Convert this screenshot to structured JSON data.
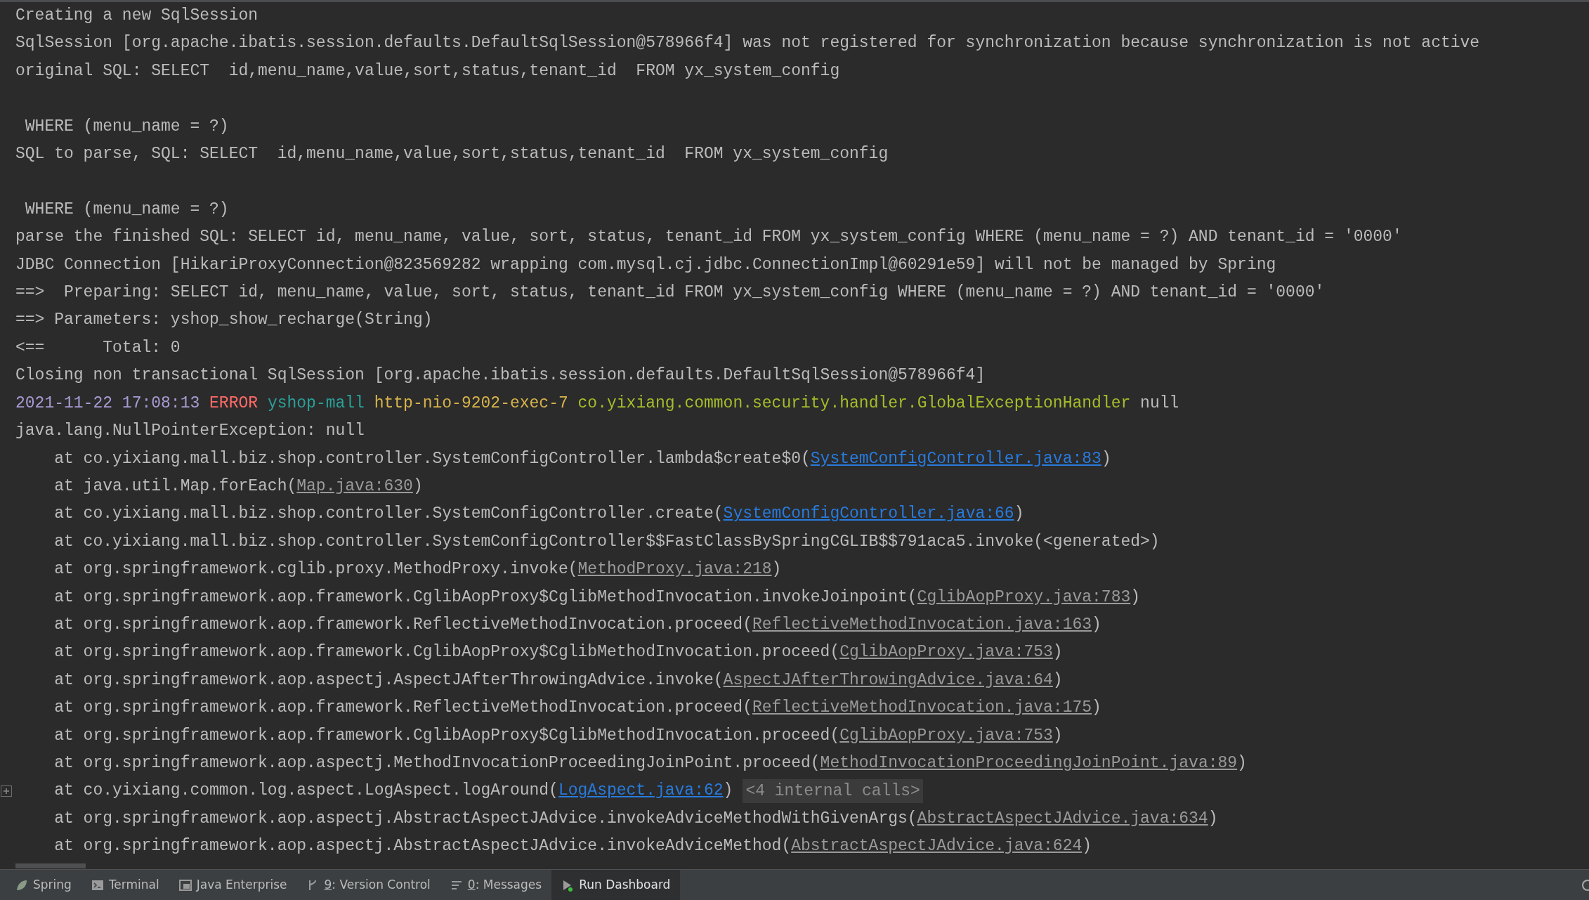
{
  "console": {
    "lines": [
      {
        "segments": [
          {
            "kind": "text",
            "text": "Creating a new SqlSession"
          }
        ]
      },
      {
        "segments": [
          {
            "kind": "text",
            "text": "SqlSession [org.apache.ibatis.session.defaults.DefaultSqlSession@578966f4] was not registered for synchronization because synchronization is not active"
          }
        ]
      },
      {
        "segments": [
          {
            "kind": "text",
            "text": "original SQL: SELECT  id,menu_name,value,sort,status,tenant_id  FROM yx_system_config\n\n WHERE (menu_name = ?)"
          }
        ]
      },
      {
        "segments": [
          {
            "kind": "text",
            "text": "SQL to parse, SQL: SELECT  id,menu_name,value,sort,status,tenant_id  FROM yx_system_config\n\n WHERE (menu_name = ?)"
          }
        ]
      },
      {
        "segments": [
          {
            "kind": "text",
            "text": "parse the finished SQL: SELECT id, menu_name, value, sort, status, tenant_id FROM yx_system_config WHERE (menu_name = ?) AND tenant_id = '0000'"
          }
        ]
      },
      {
        "segments": [
          {
            "kind": "text",
            "text": "JDBC Connection [HikariProxyConnection@823569282 wrapping com.mysql.cj.jdbc.ConnectionImpl@60291e59] will not be managed by Spring"
          }
        ]
      },
      {
        "segments": [
          {
            "kind": "text",
            "text": "==>  Preparing: SELECT id, menu_name, value, sort, status, tenant_id FROM yx_system_config WHERE (menu_name = ?) AND tenant_id = '0000'"
          }
        ]
      },
      {
        "segments": [
          {
            "kind": "text",
            "text": "==> Parameters: yshop_show_recharge(String)"
          }
        ]
      },
      {
        "segments": [
          {
            "kind": "text",
            "text": "<==      Total: 0"
          }
        ]
      },
      {
        "segments": [
          {
            "kind": "text",
            "text": "Closing non transactional SqlSession [org.apache.ibatis.session.defaults.DefaultSqlSession@578966f4]"
          }
        ]
      },
      {
        "segments": [
          {
            "kind": "date",
            "text": "2021-11-22 17:08:13 "
          },
          {
            "kind": "level",
            "text": "ERROR "
          },
          {
            "kind": "app",
            "text": "yshop-mall "
          },
          {
            "kind": "thread",
            "text": "http-nio-9202-exec-7 "
          },
          {
            "kind": "logger",
            "text": "co.yixiang.common.security.handler.GlobalExceptionHandler "
          },
          {
            "kind": "text",
            "text": "null"
          }
        ]
      },
      {
        "segments": [
          {
            "kind": "text",
            "text": "java.lang.NullPointerException: null"
          }
        ]
      },
      {
        "segments": [
          {
            "kind": "text",
            "text": "    at co.yixiang.mall.biz.shop.controller.SystemConfigController.lambda$create$0("
          },
          {
            "kind": "link",
            "text": "SystemConfigController.java:83"
          },
          {
            "kind": "text",
            "text": ")"
          }
        ]
      },
      {
        "segments": [
          {
            "kind": "text",
            "text": "    at java.util.Map.forEach("
          },
          {
            "kind": "liblink",
            "text": "Map.java:630"
          },
          {
            "kind": "text",
            "text": ")"
          }
        ]
      },
      {
        "segments": [
          {
            "kind": "text",
            "text": "    at co.yixiang.mall.biz.shop.controller.SystemConfigController.create("
          },
          {
            "kind": "link",
            "text": "SystemConfigController.java:66"
          },
          {
            "kind": "text",
            "text": ")"
          }
        ]
      },
      {
        "segments": [
          {
            "kind": "text",
            "text": "    at co.yixiang.mall.biz.shop.controller.SystemConfigController$$FastClassBySpringCGLIB$$791aca5.invoke(<generated>)"
          }
        ]
      },
      {
        "segments": [
          {
            "kind": "text",
            "text": "    at org.springframework.cglib.proxy.MethodProxy.invoke("
          },
          {
            "kind": "liblink",
            "text": "MethodProxy.java:218"
          },
          {
            "kind": "text",
            "text": ")"
          }
        ]
      },
      {
        "segments": [
          {
            "kind": "text",
            "text": "    at org.springframework.aop.framework.CglibAopProxy$CglibMethodInvocation.invokeJoinpoint("
          },
          {
            "kind": "liblink",
            "text": "CglibAopProxy.java:783"
          },
          {
            "kind": "text",
            "text": ")"
          }
        ]
      },
      {
        "segments": [
          {
            "kind": "text",
            "text": "    at org.springframework.aop.framework.ReflectiveMethodInvocation.proceed("
          },
          {
            "kind": "liblink",
            "text": "ReflectiveMethodInvocation.java:163"
          },
          {
            "kind": "text",
            "text": ")"
          }
        ]
      },
      {
        "segments": [
          {
            "kind": "text",
            "text": "    at org.springframework.aop.framework.CglibAopProxy$CglibMethodInvocation.proceed("
          },
          {
            "kind": "liblink",
            "text": "CglibAopProxy.java:753"
          },
          {
            "kind": "text",
            "text": ")"
          }
        ]
      },
      {
        "segments": [
          {
            "kind": "text",
            "text": "    at org.springframework.aop.aspectj.AspectJAfterThrowingAdvice.invoke("
          },
          {
            "kind": "liblink",
            "text": "AspectJAfterThrowingAdvice.java:64"
          },
          {
            "kind": "text",
            "text": ")"
          }
        ]
      },
      {
        "segments": [
          {
            "kind": "text",
            "text": "    at org.springframework.aop.framework.ReflectiveMethodInvocation.proceed("
          },
          {
            "kind": "liblink",
            "text": "ReflectiveMethodInvocation.java:175"
          },
          {
            "kind": "text",
            "text": ")"
          }
        ]
      },
      {
        "segments": [
          {
            "kind": "text",
            "text": "    at org.springframework.aop.framework.CglibAopProxy$CglibMethodInvocation.proceed("
          },
          {
            "kind": "liblink",
            "text": "CglibAopProxy.java:753"
          },
          {
            "kind": "text",
            "text": ")"
          }
        ]
      },
      {
        "segments": [
          {
            "kind": "text",
            "text": "    at org.springframework.aop.aspectj.MethodInvocationProceedingJoinPoint.proceed("
          },
          {
            "kind": "liblink",
            "text": "MethodInvocationProceedingJoinPoint.java:89"
          },
          {
            "kind": "text",
            "text": ")"
          }
        ]
      },
      {
        "folded": true,
        "segments": [
          {
            "kind": "text",
            "text": "    at co.yixiang.common.log.aspect.LogAspect.logAround("
          },
          {
            "kind": "link",
            "text": "LogAspect.java:62"
          },
          {
            "kind": "text",
            "text": ")"
          },
          {
            "kind": "fold",
            "text": "<4 internal calls>"
          }
        ]
      },
      {
        "segments": [
          {
            "kind": "text",
            "text": "    at org.springframework.aop.aspectj.AbstractAspectJAdvice.invokeAdviceMethodWithGivenArgs("
          },
          {
            "kind": "liblink",
            "text": "AbstractAspectJAdvice.java:634"
          },
          {
            "kind": "text",
            "text": ")"
          }
        ]
      },
      {
        "segments": [
          {
            "kind": "text",
            "text": "    at org.springframework.aop.aspectj.AbstractAspectJAdvice.invokeAdviceMethod("
          },
          {
            "kind": "liblink",
            "text": "AbstractAspectJAdvice.java:624"
          },
          {
            "kind": "text",
            "text": ")"
          }
        ]
      }
    ]
  },
  "tool_tabs": [
    {
      "kind": "leaf",
      "label": "Spring",
      "selected": false
    },
    {
      "kind": "terminal",
      "label": "Terminal",
      "selected": false
    },
    {
      "kind": "enterprise",
      "label": "Java Enterprise",
      "selected": false
    },
    {
      "kind": "vcs",
      "mnemonic": "9",
      "label": ": Version Control",
      "selected": false
    },
    {
      "kind": "messages",
      "mnemonic": "0",
      "label": ": Messages",
      "selected": false
    },
    {
      "kind": "run",
      "label": "Run Dashboard",
      "selected": true
    }
  ]
}
